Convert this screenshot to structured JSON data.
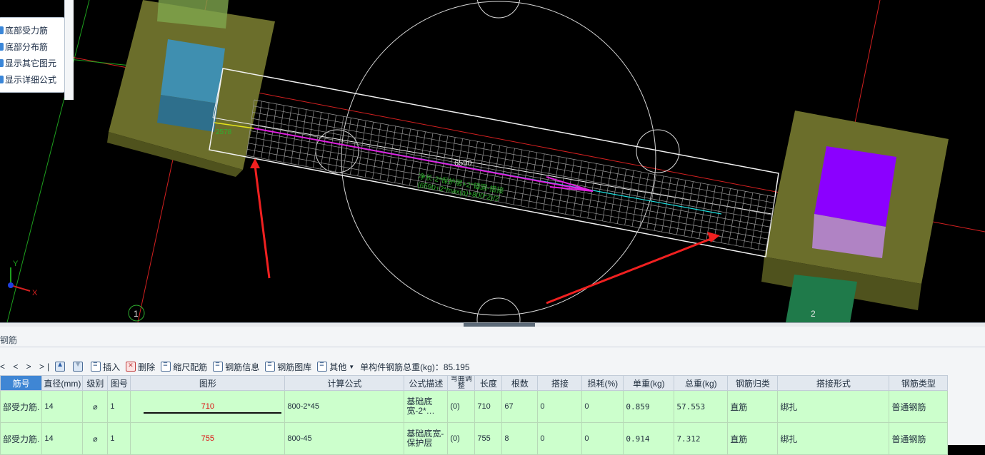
{
  "viewport": {
    "options": [
      {
        "label": "底部受力筋"
      },
      {
        "label": "底部分布筋"
      },
      {
        "label": "显示其它图元"
      },
      {
        "label": "显示详细公式"
      }
    ],
    "dimension_text": "6590",
    "dim_small_text": "2578",
    "axis_x": "X",
    "axis_y": "Y",
    "grid_label_1": "1",
    "grid_label_2": "2",
    "green_text_1": "净长-2*保护层+2*锚固-搭接",
    "green_text_2": "(6590+2*max(a)+800*2)/2"
  },
  "panel": {
    "title": "钢筋",
    "nav": "< < > >|",
    "toolbar": {
      "insert": "插入",
      "delete": "删除",
      "scale": "缩尺配筋",
      "info": "钢筋信息",
      "library": "钢筋图库",
      "other": "其他",
      "total_label": "单构件钢筋总重(kg)：85.195"
    },
    "columns": [
      "筋号",
      "直径(mm)",
      "级别",
      "图号",
      "图形",
      "计算公式",
      "公式描述",
      "弯曲调整",
      "长度",
      "根数",
      "搭接",
      "损耗(%)",
      "单重(kg)",
      "总重(kg)",
      "钢筋归类",
      "搭接形式",
      "钢筋类型"
    ],
    "rows": [
      {
        "name": "部受力筋.",
        "dia": "14",
        "grade": "⌀",
        "fig": "1",
        "shape": "710",
        "formula": "800-2*45",
        "desc": "基础底宽-2*…",
        "bend": "(0)",
        "len": "710",
        "count": "67",
        "lap": "0",
        "loss": "0",
        "unit": "0.859",
        "total": "57.553",
        "cat": "直筋",
        "lapform": "绑扎",
        "type": "普通钢筋"
      },
      {
        "name": "部受力筋.",
        "dia": "14",
        "grade": "⌀",
        "fig": "1",
        "shape": "755",
        "formula": "800-45",
        "desc": "基础底宽-保护层",
        "bend": "(0)",
        "len": "755",
        "count": "8",
        "lap": "0",
        "loss": "0",
        "unit": "0.914",
        "total": "7.312",
        "cat": "直筋",
        "lapform": "绑扎",
        "type": "普通钢筋"
      }
    ]
  },
  "colors": {
    "row_bg": "#ccffcc",
    "header_first": "#3f86d4",
    "viewport_bg": "#000000"
  }
}
